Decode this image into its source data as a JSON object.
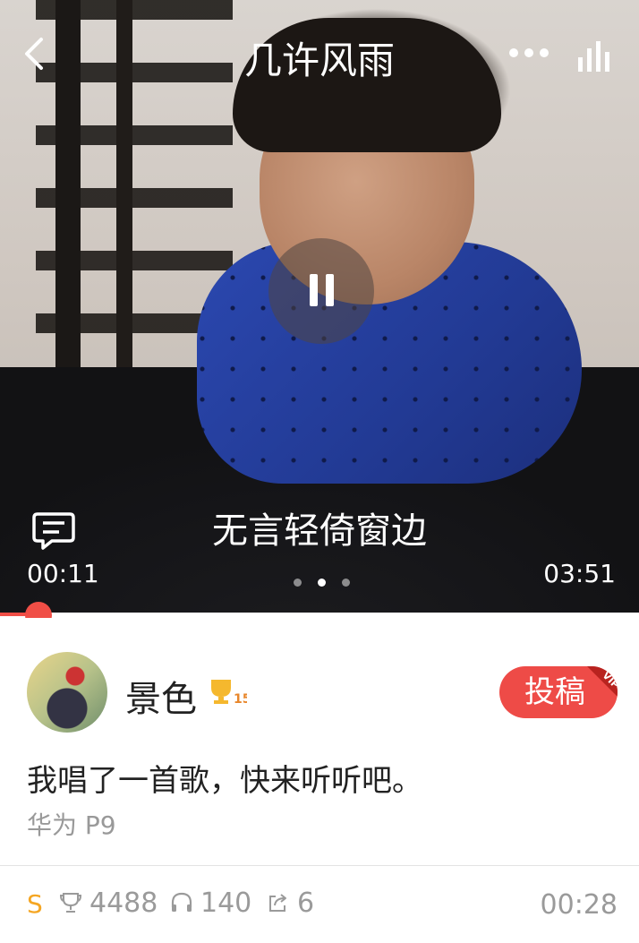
{
  "player": {
    "title": "几许风雨",
    "lyric": "无言轻倚窗边",
    "current_time": "00:11",
    "total_time": "03:51",
    "progress_fraction": 0.049,
    "page_indicator": {
      "count": 3,
      "active": 1
    },
    "icons": [
      "back-icon",
      "more-icon",
      "equalizer-icon",
      "pause-icon",
      "comment-icon"
    ]
  },
  "post": {
    "username": "景色",
    "level_badge": "15",
    "submit_label": "投稿",
    "vip_label": "VIP",
    "message": "我唱了一首歌，快来听听吧。",
    "device": "华为 P9"
  },
  "stats": {
    "badge": "S",
    "trophies": "4488",
    "listens": "140",
    "shares": "6",
    "duration": "00:28"
  },
  "colors": {
    "accent": "#f04e46",
    "gold": "#f5a623",
    "muted": "#9a9a9a"
  }
}
